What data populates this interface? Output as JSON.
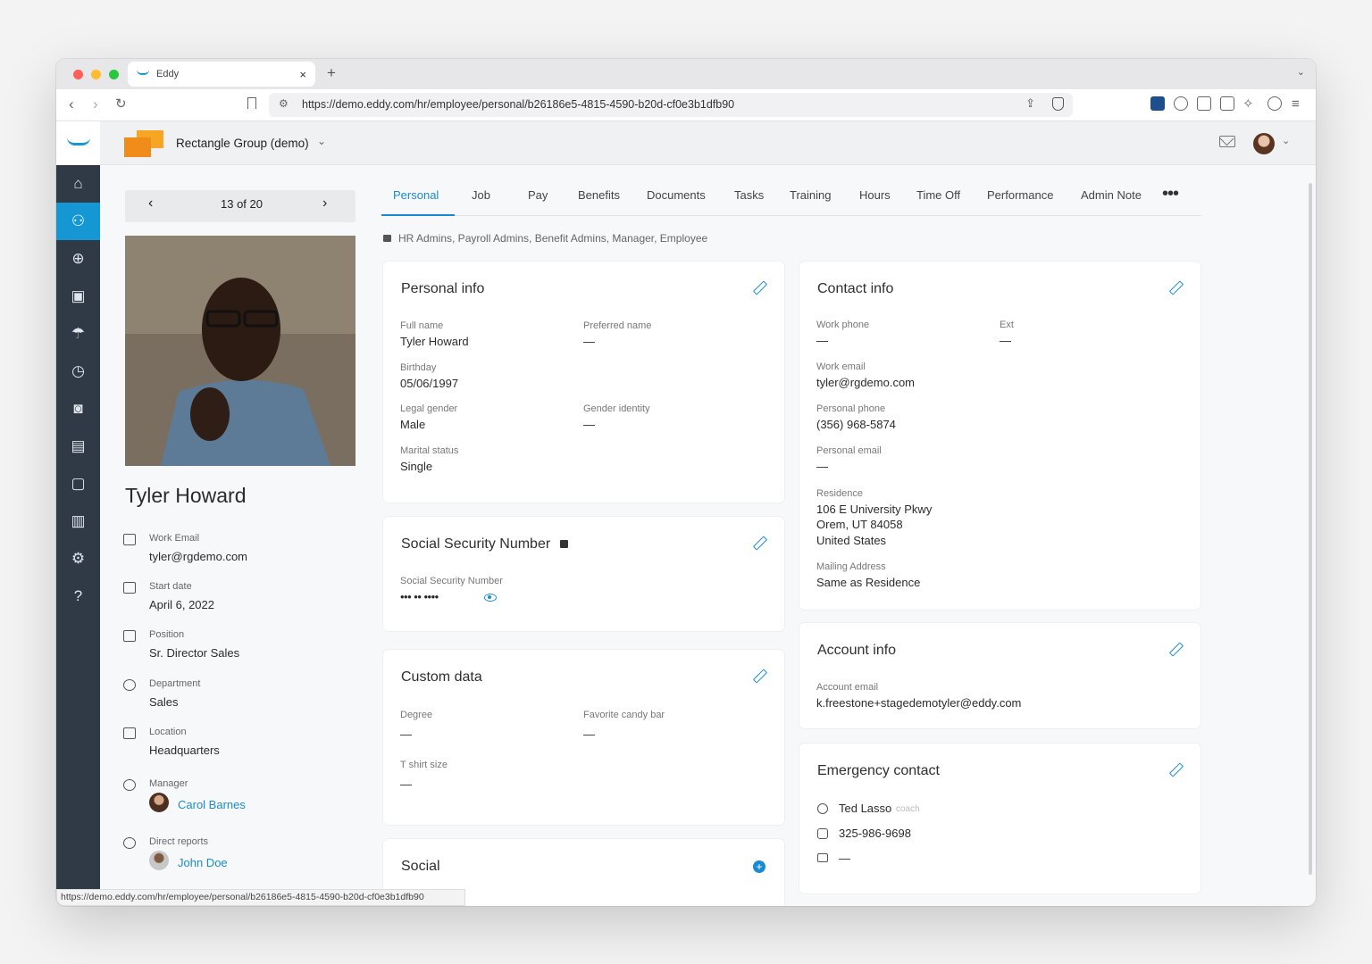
{
  "browser": {
    "tab_title": "Eddy",
    "url": "https://demo.eddy.com/hr/employee/personal/b26186e5-4815-4590-b20d-cf0e3b1dfb90",
    "status_url": "https://demo.eddy.com/hr/employee/personal/b26186e5-4815-4590-b20d-cf0e3b1dfb90"
  },
  "header": {
    "company": "Rectangle Group (demo)"
  },
  "pager": {
    "label": "13 of 20"
  },
  "employee": {
    "name": "Tyler Howard",
    "fields": [
      {
        "label": "Work Email",
        "value": "tyler@rgdemo.com"
      },
      {
        "label": "Start date",
        "value": "April 6, 2022"
      },
      {
        "label": "Position",
        "value": "Sr. Director Sales"
      },
      {
        "label": "Department",
        "value": "Sales"
      },
      {
        "label": "Location",
        "value": "Headquarters"
      },
      {
        "label": "Manager",
        "value": "Carol Barnes"
      },
      {
        "label": "Direct reports",
        "value": "John Doe"
      }
    ]
  },
  "tabs": [
    "Personal",
    "Job",
    "Pay",
    "Benefits",
    "Documents",
    "Tasks",
    "Training",
    "Hours",
    "Time Off",
    "Performance",
    "Admin Note"
  ],
  "permissions": "HR Admins, Payroll Admins, Benefit Admins, Manager, Employee",
  "personal_info": {
    "title": "Personal info",
    "full_name_label": "Full name",
    "full_name": "Tyler Howard",
    "preferred_label": "Preferred name",
    "preferred": "—",
    "birthday_label": "Birthday",
    "birthday": "05/06/1997",
    "legal_gender_label": "Legal gender",
    "legal_gender": "Male",
    "gender_identity_label": "Gender identity",
    "gender_identity": "—",
    "marital_label": "Marital status",
    "marital": "Single"
  },
  "ssn": {
    "title": "Social Security Number",
    "label": "Social Security Number",
    "value": "••• •• ••••"
  },
  "custom_data": {
    "title": "Custom data",
    "degree_label": "Degree",
    "degree": "—",
    "candy_label": "Favorite candy bar",
    "candy": "—",
    "shirt_label": "T shirt size",
    "shirt": "—"
  },
  "social": {
    "title": "Social"
  },
  "contact_info": {
    "title": "Contact info",
    "work_phone_label": "Work phone",
    "work_phone": "—",
    "ext_label": "Ext",
    "ext": "—",
    "work_email_label": "Work email",
    "work_email": "tyler@rgdemo.com",
    "personal_phone_label": "Personal phone",
    "personal_phone": "(356) 968-5874",
    "personal_email_label": "Personal email",
    "personal_email": "—",
    "residence_label": "Residence",
    "residence_line1": "106 E University Pkwy",
    "residence_line2": "Orem, UT 84058",
    "residence_line3": "United States",
    "mailing_label": "Mailing Address",
    "mailing": "Same as Residence"
  },
  "account_info": {
    "title": "Account info",
    "email_label": "Account email",
    "email": "k.freestone+stagedemotyler@eddy.com"
  },
  "emergency": {
    "title": "Emergency contact",
    "name": "Ted Lasso",
    "relation": "coach",
    "phone": "325-986-9698",
    "email": "—"
  }
}
